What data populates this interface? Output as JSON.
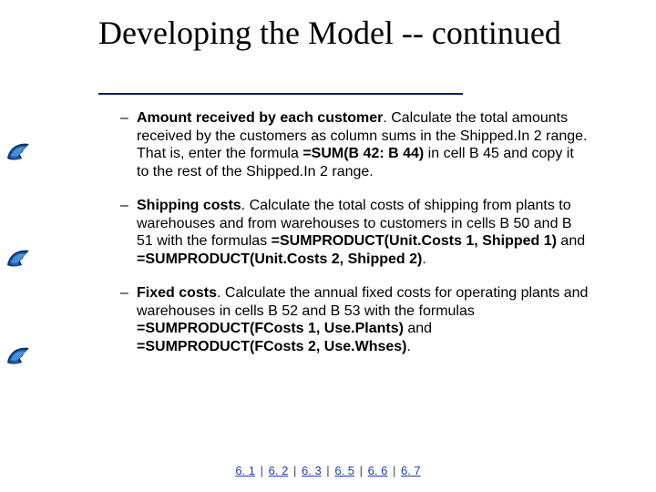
{
  "title": "Developing the Model -- continued",
  "bullets": [
    {
      "lead": "Amount received by each customer",
      "rest1": ". Calculate the total amounts received by the customers as column sums in the Shipped.In 2 range. That is, enter the formula ",
      "formula": "=SUM(B 42: B 44)",
      "rest2": " in cell B 45 and copy it to the rest of the Shipped.In 2 range."
    },
    {
      "lead": "Shipping costs",
      "rest1": ". Calculate the total costs of shipping from plants to warehouses and from warehouses to customers in cells B 50 and B 51 with the formulas ",
      "formula": "=SUMPRODUCT(Unit.Costs 1, Shipped 1)",
      "mid": " and ",
      "formula2": "=SUMPRODUCT(Unit.Costs 2, Shipped 2)",
      "rest2": "."
    },
    {
      "lead": "Fixed costs",
      "rest1": ". Calculate the annual fixed costs for operating plants and warehouses in cells B 52 and B 53 with the formulas ",
      "formula": "=SUMPRODUCT(FCosts 1, Use.Plants)",
      "mid": " and ",
      "formula2": "=SUMPRODUCT(FCosts 2, Use.Whses)",
      "rest2": "."
    }
  ],
  "footer": {
    "links": [
      "6. 1",
      "6. 2",
      "6. 3",
      "6. 5",
      "6. 6",
      "6. 7"
    ],
    "sep": "|"
  }
}
